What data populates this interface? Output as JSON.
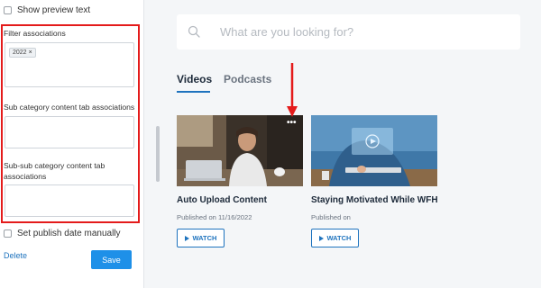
{
  "left_panel": {
    "show_preview_label": "Show preview text",
    "filter_associations_label": "Filter associations",
    "filter_chip": "2022",
    "filter_chip_remove": "×",
    "subcategory_label": "Sub category content tab associations",
    "subsubcategory_label": "Sub-sub category content tab associations",
    "publish_manually_label": "Set publish date manually",
    "delete_label": "Delete",
    "save_label": "Save"
  },
  "search": {
    "placeholder": "What are you looking for?"
  },
  "tabs": [
    {
      "label": "Videos",
      "active": true
    },
    {
      "label": "Podcasts",
      "active": false
    }
  ],
  "cards": [
    {
      "title": "Auto Upload Content",
      "date": "Published on 11/16/2022",
      "watch_label": "WATCH",
      "menu": "•••"
    },
    {
      "title": "Staying Motivated While WFH",
      "date": "Published on",
      "watch_label": "WATCH"
    }
  ],
  "colors": {
    "accent": "#1e73be",
    "save_button": "#1e90e8",
    "highlight": "#e41b1b",
    "background": "#f4f6f8"
  }
}
